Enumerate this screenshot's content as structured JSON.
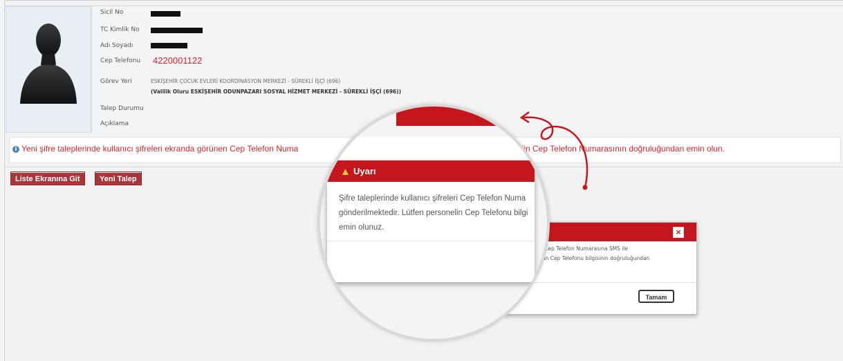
{
  "profile": {
    "labels": {
      "sicil_no": "Sicil No",
      "tc_kimlik_no": "TC Kimlik No",
      "adi_soyadi": "Adı Soyadı",
      "cep_telefonu": "Cep Telefonu",
      "gorev_yeri": "Görev Yeri",
      "talep_durumu": "Talep Durumu",
      "aciklama": "Açıklama"
    },
    "phone": "4220001122",
    "gorev_line1": "ESKİŞEHİR ÇOCUK EVLERİ KOORDİNASYON MERKEZİ - SÜREKLİ İŞÇİ (696)",
    "gorev_line2": "(Valilik Oluru ESKİŞEHİR ODUNPAZARI SOSYAL HİZMET MERKEZİ - SÜREKLİ İŞÇİ (696))"
  },
  "info": {
    "text_left": "Yeni şifre taleplerinde kullanıcı şifreleri ekranda görünen Cep Telefon Numa",
    "text_right": "elin Cep Telefon Numarasının doğruluğundan emin olun."
  },
  "buttons": {
    "liste": "Liste Ekranına Git",
    "yeni_talep": "Yeni Talep"
  },
  "dialog": {
    "close_glyph": "×",
    "line1": "eri Cep Telefon Numarasına SMS ile",
    "line2": "nelin Cep Telefonu bilgisinin doğruluğundan",
    "ok_label": "Tamam"
  },
  "magnified": {
    "title": "Uyarı",
    "body": "Şifre taleplerinde kullanıcı şifreleri Cep Telefon Numa\ngönderilmektedir. Lütfen personelin Cep Telefonu bilgi\nemin olunuz."
  },
  "colors": {
    "accent_red": "#c4161c",
    "text_red": "#d9232d",
    "button_red": "#a8353a",
    "info_blue": "#4a84c0"
  },
  "icons": {
    "avatar": "person-silhouette-icon",
    "info": "info-icon",
    "warning": "warning-icon",
    "close": "close-icon",
    "arrow": "curved-arrow-icon"
  }
}
